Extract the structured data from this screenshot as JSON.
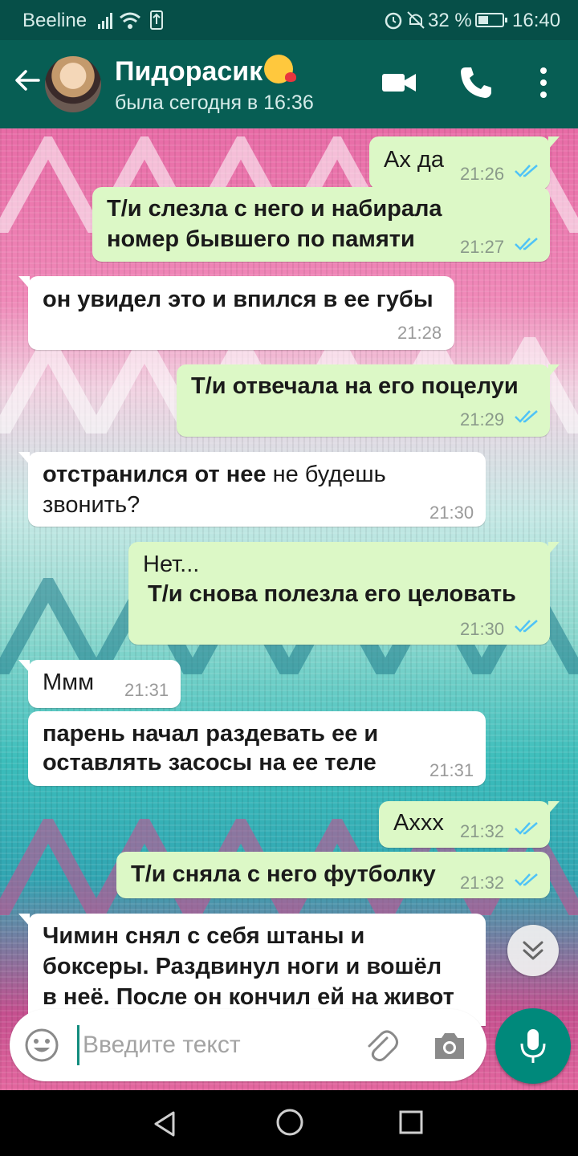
{
  "status_bar": {
    "carrier": "Beeline",
    "battery_percent": "32 %",
    "time": "16:40"
  },
  "header": {
    "contact_name": "Пидорасик",
    "contact_status": "была сегодня в 16:36",
    "icons": [
      "back-arrow-icon",
      "avatar",
      "video-call-icon",
      "phone-icon",
      "more-vert-icon"
    ]
  },
  "messages": [
    {
      "dir": "out",
      "lines": [
        "Ах да"
      ],
      "time": "21:26"
    },
    {
      "dir": "out",
      "lines": [
        "Т/и слезла с него и набирала",
        "номер бывшего по памяти"
      ],
      "time": "21:27"
    },
    {
      "dir": "in",
      "lines": [
        "он увидел это и впился в ее губы"
      ],
      "time": "21:28"
    },
    {
      "dir": "out",
      "lines": [
        "Т/и отвечала на его поцелуи"
      ],
      "time": "21:29"
    },
    {
      "dir": "in",
      "bold_part": "отстранился от нее",
      "lines": [
        " не будешь",
        "звонить?"
      ],
      "time": "21:30"
    },
    {
      "dir": "out",
      "lines": [
        "Нет...",
        "Т/и снова полезла его целовать"
      ],
      "time": "21:30"
    },
    {
      "dir": "in",
      "lines": [
        "Ммм"
      ],
      "time": "21:31"
    },
    {
      "dir": "in",
      "lines": [
        "парень начал раздевать ее и",
        "оставлять засосы на ее теле"
      ],
      "time": "21:31"
    },
    {
      "dir": "out",
      "lines": [
        "Аххх"
      ],
      "time": "21:32"
    },
    {
      "dir": "out",
      "lines": [
        "Т/и сняла с него футболку"
      ],
      "time": "21:32"
    },
    {
      "dir": "in",
      "lines": [
        "Чимин снял с себя штаны и",
        "боксеры. Раздвинул ноги и вошёл",
        "в неё. После он кончил ей на живот"
      ],
      "time": ""
    }
  ],
  "input": {
    "placeholder": "Введите текст"
  },
  "colors": {
    "header": "#075e54",
    "status_bar": "#064f48",
    "outgoing_bubble": "#dcf8c6",
    "incoming_bubble": "#ffffff",
    "mic_button": "#00897b",
    "read_ticks": "#4fc3f7"
  }
}
